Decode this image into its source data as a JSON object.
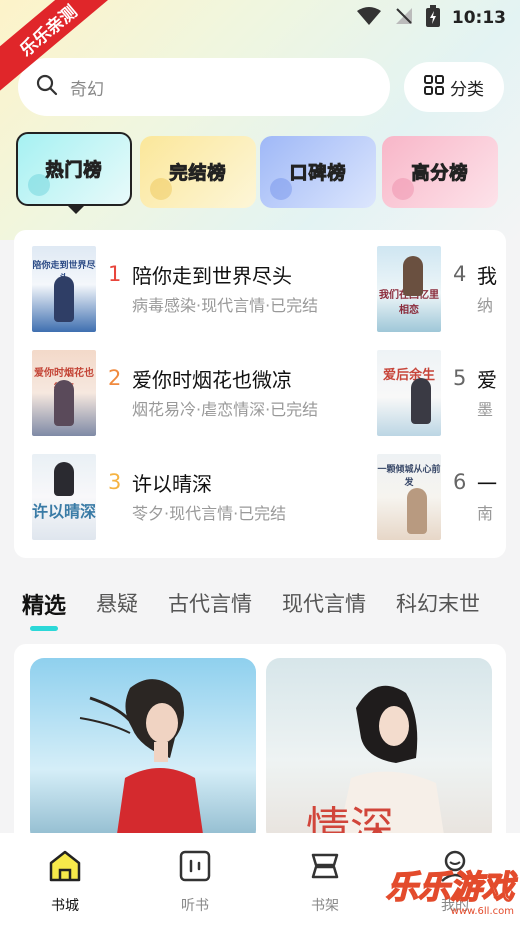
{
  "watermark": {
    "ribbon": "乐乐亲测",
    "site_name": "乐乐游戏",
    "site_url": "www.6ll.com"
  },
  "status_bar": {
    "time": "10:13"
  },
  "search": {
    "placeholder": "奇幻",
    "category_label": "分类"
  },
  "rank_tabs": [
    {
      "label": "热门榜",
      "active": true
    },
    {
      "label": "完结榜",
      "active": false
    },
    {
      "label": "口碑榜",
      "active": false
    },
    {
      "label": "高分榜",
      "active": false
    }
  ],
  "rank_books": [
    {
      "rank": "1",
      "title": "陪你走到世界尽头",
      "meta": "病毒感染·现代言情·已完结",
      "cover_text": "陪你走到世界尽头"
    },
    {
      "rank": "2",
      "title": "爱你时烟花也微凉",
      "meta": "烟花易冷·虐恋情深·已完结",
      "cover_text": "爱你时烟花也微凉"
    },
    {
      "rank": "3",
      "title": "许以晴深",
      "meta": "苓夕·现代言情·已完结",
      "cover_text": "许以晴深"
    },
    {
      "rank": "4",
      "title": "我",
      "meta": "纳",
      "cover_text": "我们在回忆里相恋"
    },
    {
      "rank": "5",
      "title": "爱",
      "meta": "墨",
      "cover_text": "爱后余生"
    },
    {
      "rank": "6",
      "title": "一",
      "meta": "南",
      "cover_text": "一颗倾城从心前发"
    }
  ],
  "genre_tabs": [
    {
      "label": "精选",
      "active": true
    },
    {
      "label": "悬疑",
      "active": false
    },
    {
      "label": "古代言情",
      "active": false
    },
    {
      "label": "现代言情",
      "active": false
    },
    {
      "label": "科幻末世",
      "active": false
    }
  ],
  "featured": {
    "second_overlay": "情深"
  },
  "bottom_nav": [
    {
      "label": "书城",
      "icon": "home-icon",
      "active": true
    },
    {
      "label": "听书",
      "icon": "audio-icon",
      "active": false
    },
    {
      "label": "书架",
      "icon": "bookshelf-icon",
      "active": false
    },
    {
      "label": "我的",
      "icon": "profile-icon",
      "active": false
    }
  ],
  "colors": {
    "accent": "#2cd8d8",
    "rank_1": "#e8453c",
    "rank_2": "#f08a3e",
    "rank_3": "#f5b342",
    "rank_other": "#666666"
  }
}
